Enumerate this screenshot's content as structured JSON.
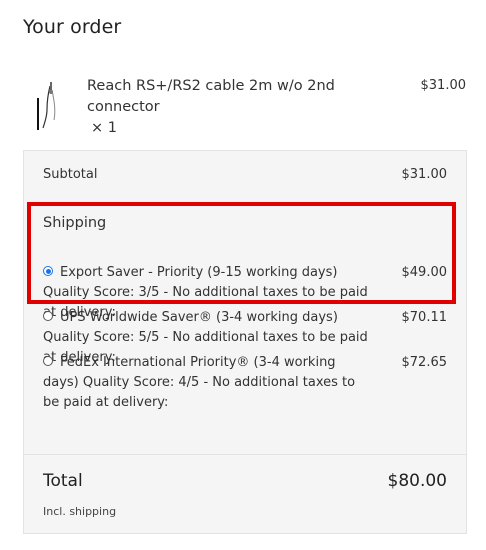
{
  "heading": "Your order",
  "product": {
    "name": "Reach RS+/RS2 cable 2m w/o 2nd connector",
    "qty": "× 1",
    "price": "$31.00"
  },
  "summary": {
    "subtotal_label": "Subtotal",
    "subtotal_value": "$31.00",
    "shipping_title": "Shipping",
    "options": [
      {
        "label": "Export Saver - Priority (9-15 working days) Quality Score: 3/5 - No additional taxes to be paid at delivery:",
        "price": "$49.00",
        "selected": true
      },
      {
        "label": "UPS Worldwide Saver® (3-4 working days) Quality Score: 5/5 - No additional taxes to be paid at delivery:",
        "price": "$70.11",
        "selected": false
      },
      {
        "label": "FedEx International Priority® (3-4 working days) Quality Score: 4/5 - No additional taxes to be paid at delivery:",
        "price": "$72.65",
        "selected": false
      }
    ],
    "total_label": "Total",
    "total_value": "$80.00",
    "incl_note": "Incl. shipping"
  },
  "colors": {
    "highlight": "#e00000",
    "radio_accent": "#1a73e8",
    "panel_bg": "#f5f5f5"
  }
}
